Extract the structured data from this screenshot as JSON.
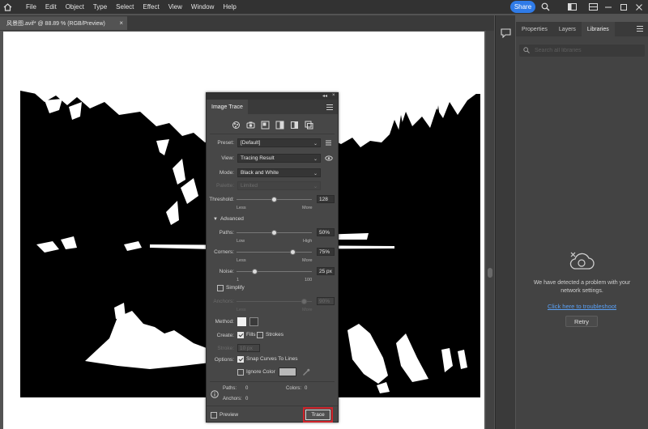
{
  "menubar": {
    "items": [
      "File",
      "Edit",
      "Object",
      "Type",
      "Select",
      "Effect",
      "View",
      "Window",
      "Help"
    ],
    "share_label": "Share"
  },
  "document_tab": {
    "title": "风景图.avif* @ 88.89 % (RGB/Preview)",
    "close_glyph": "×"
  },
  "right_panel": {
    "tabs": [
      "Properties",
      "Layers",
      "Libraries"
    ],
    "active_tab": "Libraries",
    "search_placeholder": "Search all libraries",
    "message": "We have detected a problem with your network settings.",
    "link_text": "Click here to troubleshoot",
    "retry_label": "Retry"
  },
  "image_trace": {
    "title": "Image Trace",
    "preset_label": "Preset:",
    "preset_value": "[Default]",
    "view_label": "View:",
    "view_value": "Tracing Result",
    "mode_label": "Mode:",
    "mode_value": "Black and White",
    "palette_label": "Palette:",
    "palette_value": "Limited",
    "threshold_label": "Threshold:",
    "threshold_value": "128",
    "threshold_level": 0.5,
    "threshold_min": "Less",
    "threshold_max": "More",
    "advanced_label": "Advanced",
    "paths_label": "Paths:",
    "paths_value": "50%",
    "paths_level": 0.5,
    "paths_min": "Low",
    "paths_max": "High",
    "corners_label": "Corners:",
    "corners_value": "75%",
    "corners_level": 0.75,
    "corners_min": "Less",
    "corners_max": "More",
    "noise_label": "Noise:",
    "noise_value": "25 px",
    "noise_level": 0.25,
    "noise_min": "1",
    "noise_max": "100",
    "simplify_label": "Simplify",
    "anchors_label": "Anchors:",
    "anchors_value": "90%",
    "anchors_min": "Less",
    "anchors_max": "More",
    "method_label": "Method:",
    "create_label": "Create:",
    "fills_label": "Fills",
    "strokes_label": "Strokes",
    "stroke_label": "Stroke:",
    "stroke_value": "10 px",
    "options_label": "Options:",
    "snap_label": "Snap Curves To Lines",
    "ignore_color_label": "Ignore Color",
    "stats_paths_label": "Paths:",
    "stats_paths_value": "0",
    "stats_anchors_label": "Anchors:",
    "stats_anchors_value": "0",
    "stats_colors_label": "Colors:",
    "stats_colors_value": "0",
    "preview_label": "Preview",
    "trace_label": "Trace",
    "highlight_color": "#d0232a"
  }
}
